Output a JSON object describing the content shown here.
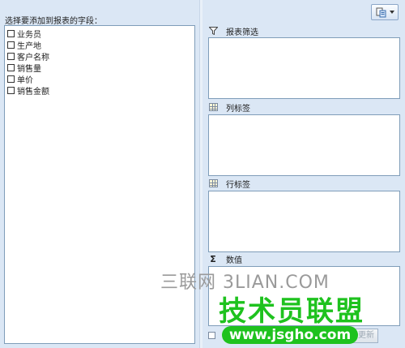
{
  "field_list": {
    "header": "选择要添加到报表的字段：",
    "fields": [
      "业务员",
      "生产地",
      "客户名称",
      "销售量",
      "单价",
      "销售金额"
    ]
  },
  "areas": {
    "filter": {
      "label": "报表筛选",
      "icon": "filter-icon"
    },
    "columns": {
      "label": "列标签",
      "icon": "column-grid-icon"
    },
    "rows": {
      "label": "行标签",
      "icon": "row-grid-icon"
    },
    "values": {
      "label": "数值",
      "icon": "sigma-icon"
    }
  },
  "footer": {
    "update_label": "更新"
  },
  "watermarks": {
    "site_1": "三联网 3LIAN.COM",
    "site_2": "技术员联盟",
    "site_3": "www.jsgho.com"
  },
  "colors": {
    "background": "#dbe7f5",
    "border": "#7f9db9",
    "watermark_green": "#1ec21e"
  }
}
